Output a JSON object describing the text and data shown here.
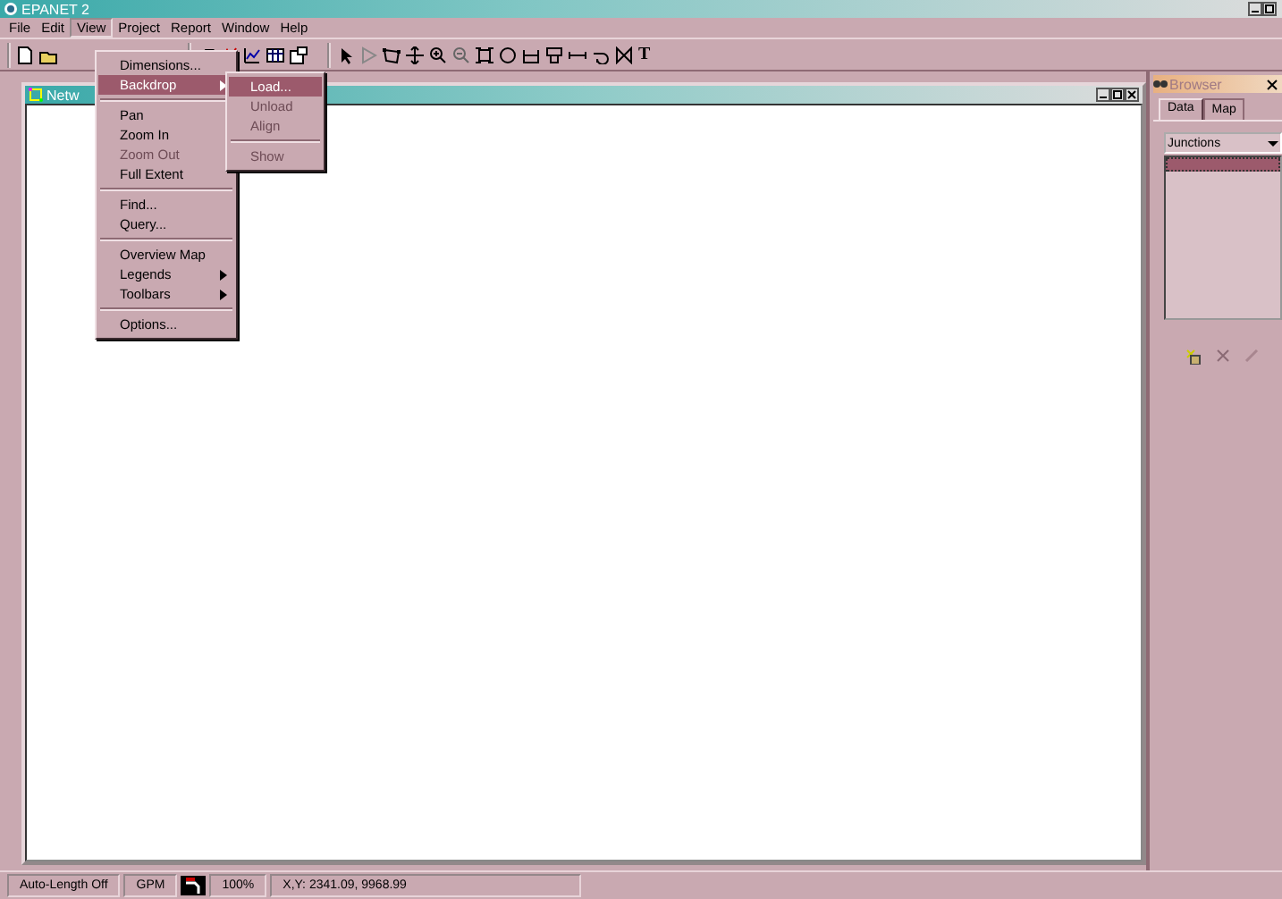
{
  "window": {
    "title": "EPANET 2"
  },
  "menu_bar": [
    {
      "label": "File",
      "selected": false
    },
    {
      "label": "Edit",
      "selected": false
    },
    {
      "label": "View",
      "selected": true
    },
    {
      "label": "Project",
      "selected": false
    },
    {
      "label": "Report",
      "selected": false
    },
    {
      "label": "Window",
      "selected": false
    },
    {
      "label": "Help",
      "selected": false
    }
  ],
  "view_menu": [
    {
      "kind": "item",
      "label": "Dimensions...",
      "disabled": false,
      "selected": false,
      "submenu": false
    },
    {
      "kind": "item",
      "label": "Backdrop",
      "disabled": false,
      "selected": true,
      "submenu": true
    },
    {
      "kind": "separator"
    },
    {
      "kind": "item",
      "label": "Pan",
      "disabled": false,
      "selected": false,
      "submenu": false
    },
    {
      "kind": "item",
      "label": "Zoom In",
      "disabled": false,
      "selected": false,
      "submenu": false
    },
    {
      "kind": "item",
      "label": "Zoom Out",
      "disabled": true,
      "selected": false,
      "submenu": false
    },
    {
      "kind": "item",
      "label": "Full Extent",
      "disabled": false,
      "selected": false,
      "submenu": false
    },
    {
      "kind": "separator"
    },
    {
      "kind": "item",
      "label": "Find...",
      "disabled": false,
      "selected": false,
      "submenu": false
    },
    {
      "kind": "item",
      "label": "Query...",
      "disabled": false,
      "selected": false,
      "submenu": false
    },
    {
      "kind": "separator"
    },
    {
      "kind": "item",
      "label": "Overview Map",
      "disabled": false,
      "selected": false,
      "submenu": false
    },
    {
      "kind": "item",
      "label": "Legends",
      "disabled": false,
      "selected": false,
      "submenu": true
    },
    {
      "kind": "item",
      "label": "Toolbars",
      "disabled": false,
      "selected": false,
      "submenu": true
    },
    {
      "kind": "separator"
    },
    {
      "kind": "item",
      "label": "Options...",
      "disabled": false,
      "selected": false,
      "submenu": false
    }
  ],
  "backdrop_submenu": [
    {
      "kind": "item",
      "label": "Load...",
      "disabled": false,
      "selected": true
    },
    {
      "kind": "item",
      "label": "Unload",
      "disabled": true,
      "selected": false
    },
    {
      "kind": "item",
      "label": "Align",
      "disabled": true,
      "selected": false
    },
    {
      "kind": "separator"
    },
    {
      "kind": "item",
      "label": "Show",
      "disabled": true,
      "selected": false
    }
  ],
  "map_toolbar": {
    "text_tool": "T"
  },
  "network_window": {
    "title": "Netw"
  },
  "browser": {
    "title": "Browser",
    "tabs": [
      {
        "label": "Data",
        "selected": true
      },
      {
        "label": "Map",
        "selected": false
      }
    ],
    "object_type": "Junctions"
  },
  "status_bar": {
    "auto_length": "Auto-Length Off",
    "flow_units": "GPM",
    "zoom": "100%",
    "coordinates": "X,Y: 2341.09, 9968.99"
  }
}
